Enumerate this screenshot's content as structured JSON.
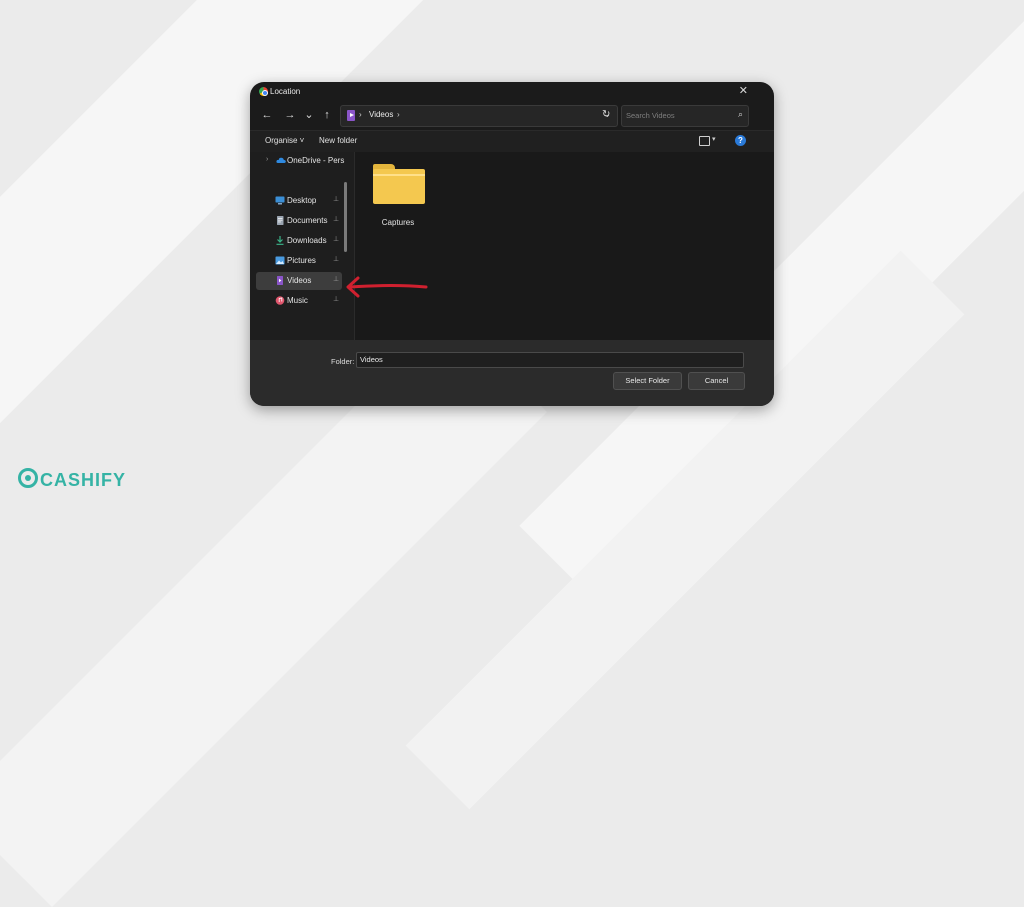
{
  "dialog": {
    "title": "Location",
    "close_glyph": "✕",
    "nav": {
      "back": "←",
      "forward": "→",
      "recent": "⌄",
      "up": "↑"
    },
    "address": {
      "sep1": "›",
      "crumb": "Videos",
      "sep2": "›",
      "dropdown": "⌄"
    },
    "refresh_glyph": "↻",
    "search": {
      "placeholder": "Search Videos",
      "icon_glyph": "⌕"
    },
    "commands": {
      "organise": "Organise ˅",
      "new_folder": "New folder",
      "view_caret": "▾",
      "help": "?"
    },
    "sidebar": {
      "onedrive": "OneDrive - Pers",
      "items": [
        {
          "label": "Desktop",
          "icon": "desktop-icon",
          "color": "#3b8fd6",
          "pinned": true
        },
        {
          "label": "Documents",
          "icon": "documents-icon",
          "color": "#9aa4b0",
          "pinned": true
        },
        {
          "label": "Downloads",
          "icon": "downloads-icon",
          "color": "#3bb58a",
          "pinned": true
        },
        {
          "label": "Pictures",
          "icon": "pictures-icon",
          "color": "#4a9be0",
          "pinned": true
        },
        {
          "label": "Videos",
          "icon": "videos-icon",
          "color": "#8a55c9",
          "pinned": true,
          "selected": true
        },
        {
          "label": "Music",
          "icon": "music-icon",
          "color": "#e0566d",
          "pinned": true
        }
      ],
      "pin_glyph": "📌"
    },
    "content": {
      "items": [
        {
          "label": "Captures",
          "icon": "folder-icon"
        }
      ]
    },
    "footer": {
      "folder_label": "Folder:",
      "folder_value": "Videos",
      "select_button": "Select Folder",
      "cancel_button": "Cancel"
    }
  },
  "annotation": {
    "arrow_color": "#d0202f"
  },
  "brand": {
    "name": "CASHIFY",
    "color": "#35b3a5"
  }
}
